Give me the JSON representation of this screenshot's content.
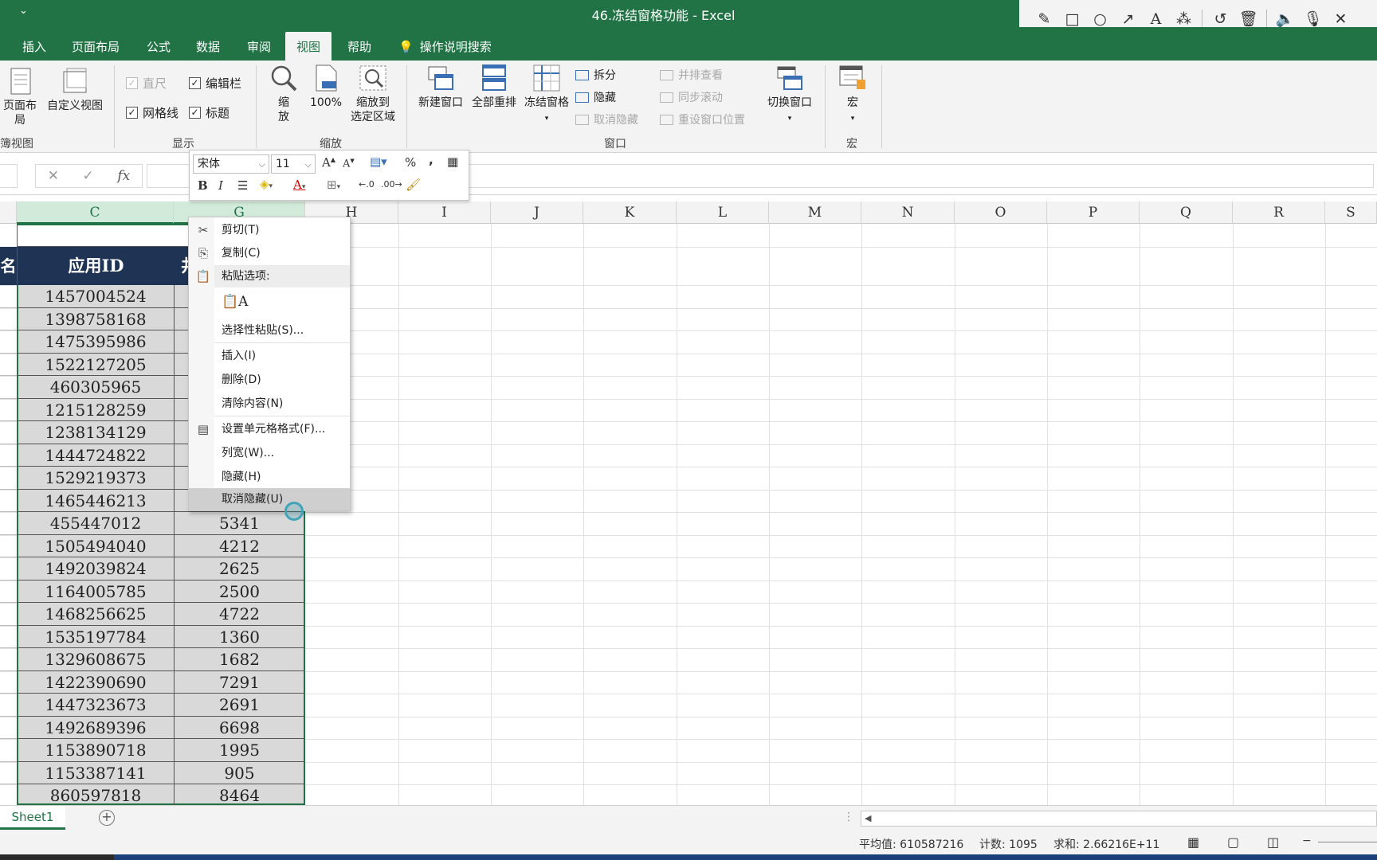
{
  "window": {
    "title": "46.冻结窗格功能  -  Excel",
    "quick_access": "⌄"
  },
  "annotation_toolbar": {
    "tools": [
      "pencil-icon",
      "rectangle-icon",
      "circle-icon",
      "arrow-icon",
      "text-icon",
      "magic-wand-icon",
      "undo-icon",
      "trash-icon",
      "speaker-icon",
      "microphone-icon",
      "close-icon"
    ]
  },
  "menu_tabs": [
    {
      "label": "插入"
    },
    {
      "label": "页面布局"
    },
    {
      "label": "公式"
    },
    {
      "label": "数据"
    },
    {
      "label": "审阅"
    },
    {
      "label": "视图",
      "active": true
    },
    {
      "label": "帮助"
    }
  ],
  "tell_me": "操作说明搜索",
  "ribbon": {
    "workbook_views": {
      "page_layout": "页面布局",
      "custom_view": "自定义视图",
      "group_label": "簿视图"
    },
    "show": {
      "ruler": "直尺",
      "formula_bar": "编辑栏",
      "gridlines": "网格线",
      "headings": "标题",
      "group_label": "显示"
    },
    "zoom": {
      "zoom": "缩\n放",
      "zoom_1": "缩",
      "zoom_2": "放",
      "hundred": "100%",
      "zoom_sel_1": "缩放到",
      "zoom_sel_2": "选定区域",
      "group_label": "缩放"
    },
    "window": {
      "new_window": "新建窗口",
      "arrange_all": "全部重排",
      "freeze_panes": "冻结窗格",
      "split": "拆分",
      "hide": "隐藏",
      "unhide": "取消隐藏",
      "side_by_side": "并排查看",
      "sync_scroll": "同步滚动",
      "reset_pos": "重设窗口位置",
      "switch_windows": "切换窗口",
      "group_label": "窗口"
    },
    "macros": {
      "macros": "宏",
      "group_label": "宏"
    }
  },
  "columns": [
    "C",
    "G",
    "H",
    "I",
    "J",
    "K",
    "L",
    "M",
    "N",
    "O",
    "P",
    "Q",
    "R",
    "S"
  ],
  "table": {
    "header_left": "名",
    "header_c": "应用ID",
    "header_g": "井",
    "rows": [
      [
        "1457004524",
        ""
      ],
      [
        "1398758168",
        ""
      ],
      [
        "1475395986",
        ""
      ],
      [
        "1522127205",
        ""
      ],
      [
        "460305965",
        ""
      ],
      [
        "1215128259",
        ""
      ],
      [
        "1238134129",
        ""
      ],
      [
        "1444724822",
        ""
      ],
      [
        "1529219373",
        ""
      ],
      [
        "1465446213",
        ""
      ],
      [
        "455447012",
        "5341"
      ],
      [
        "1505494040",
        "4212"
      ],
      [
        "1492039824",
        "2625"
      ],
      [
        "1164005785",
        "2500"
      ],
      [
        "1468256625",
        "4722"
      ],
      [
        "1535197784",
        "1360"
      ],
      [
        "1329608675",
        "1682"
      ],
      [
        "1422390690",
        "7291"
      ],
      [
        "1447323673",
        "2691"
      ],
      [
        "1492689396",
        "6698"
      ],
      [
        "1153890718",
        "1995"
      ],
      [
        "1153387141",
        "905"
      ],
      [
        "860597818",
        "8464"
      ]
    ]
  },
  "mini_toolbar": {
    "font": "宋体",
    "size": "11"
  },
  "context_menu": {
    "cut": "剪切(T)",
    "copy": "复制(C)",
    "paste_options": "粘贴选项:",
    "paste_special": "选择性粘贴(S)...",
    "insert": "插入(I)",
    "delete": "删除(D)",
    "clear": "清除内容(N)",
    "format_cells": "设置单元格格式(F)...",
    "col_width": "列宽(W)...",
    "hide": "隐藏(H)",
    "unhide": "取消隐藏(U)"
  },
  "sheet_tab": "Sheet1",
  "status": {
    "average": "平均值: 610587216",
    "count": "计数: 1095",
    "sum": "求和: 2.66216E+11"
  },
  "colors": {
    "accent": "#217346",
    "header_fill": "#1f3354"
  }
}
